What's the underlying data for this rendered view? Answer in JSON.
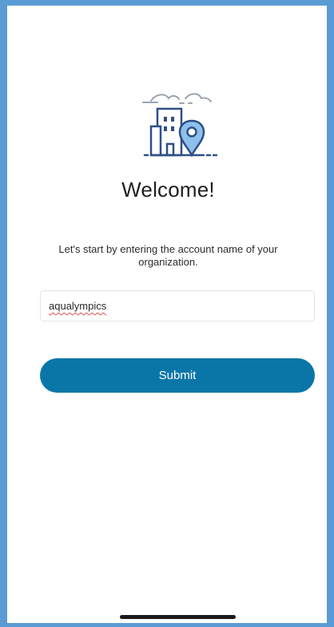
{
  "welcome": {
    "title": "Welcome!",
    "instructions": "Let's start by entering the account name of your organization."
  },
  "account_input": {
    "value": "aqualympics"
  },
  "submit_button": {
    "label": "Submit"
  },
  "colors": {
    "frame_border": "#5b9bd5",
    "button_background": "#0a76a8",
    "illustration_stroke": "#2f4f87",
    "pin_fill": "#8ec0ec"
  },
  "icons": {
    "hero": "building-location-pin-icon"
  }
}
